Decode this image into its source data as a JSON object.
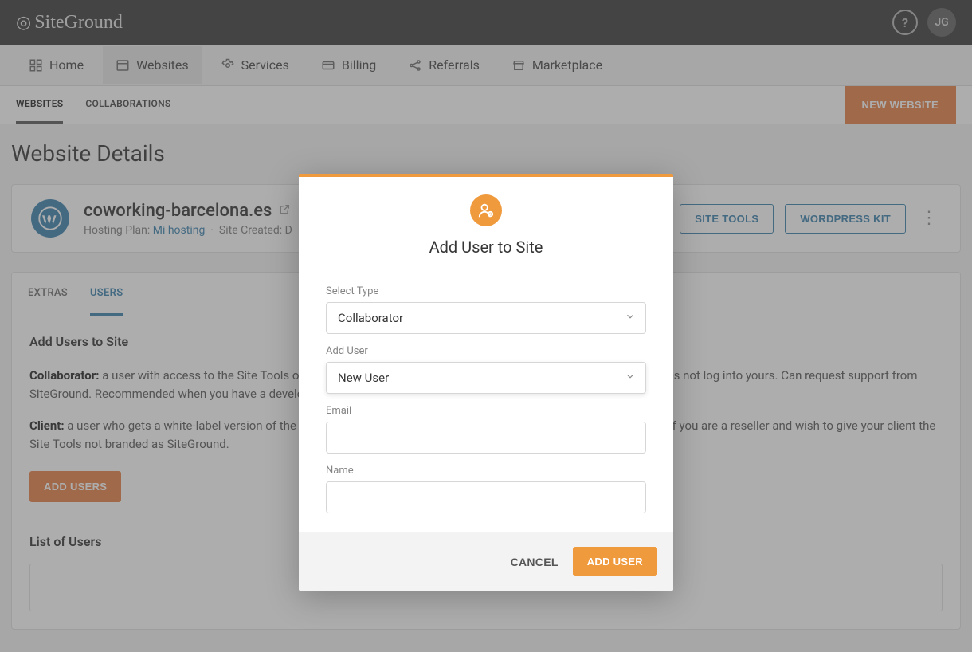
{
  "brand": "SiteGround",
  "avatar_initials": "JG",
  "mainnav": {
    "home": "Home",
    "websites": "Websites",
    "services": "Services",
    "billing": "Billing",
    "referrals": "Referrals",
    "marketplace": "Marketplace"
  },
  "subnav": {
    "websites": "WEBSITES",
    "collaborations": "COLLABORATIONS",
    "new_website": "NEW WEBSITE"
  },
  "page_title": "Website Details",
  "site": {
    "domain": "coworking-barcelona.es",
    "hosting_label": "Hosting Plan:",
    "hosting_plan": "Mi hosting",
    "created_label": "Site Created: D",
    "site_tools": "SITE TOOLS",
    "wordpress_kit": "WORDPRESS KIT"
  },
  "panel": {
    "tab_extras": "EXTRAS",
    "tab_users": "USERS",
    "heading": "Add Users to Site",
    "p1_label": "Collaborator:",
    "p1_text": " a user with access to the Site Tools of your site. The Collaborator has their own SiteGround account and does not log into yours. Can request support from SiteGround. Recommended when you have a developer/designer that you want to collaborate on your site.",
    "p2_label": "Client:",
    "p2_text": " a user who gets a white-label version of the Site Tools and can't request support from SiteGround. Recommended if you are a reseller and wish to give your client the Site Tools not branded as SiteGround.",
    "add_users_btn": "ADD USERS",
    "list_heading": "List of Users"
  },
  "modal": {
    "title": "Add User to Site",
    "select_type_label": "Select Type",
    "select_type_value": "Collaborator",
    "add_user_label": "Add User",
    "add_user_value": "New User",
    "email_label": "Email",
    "name_label": "Name",
    "cancel": "CANCEL",
    "confirm": "ADD USER"
  }
}
